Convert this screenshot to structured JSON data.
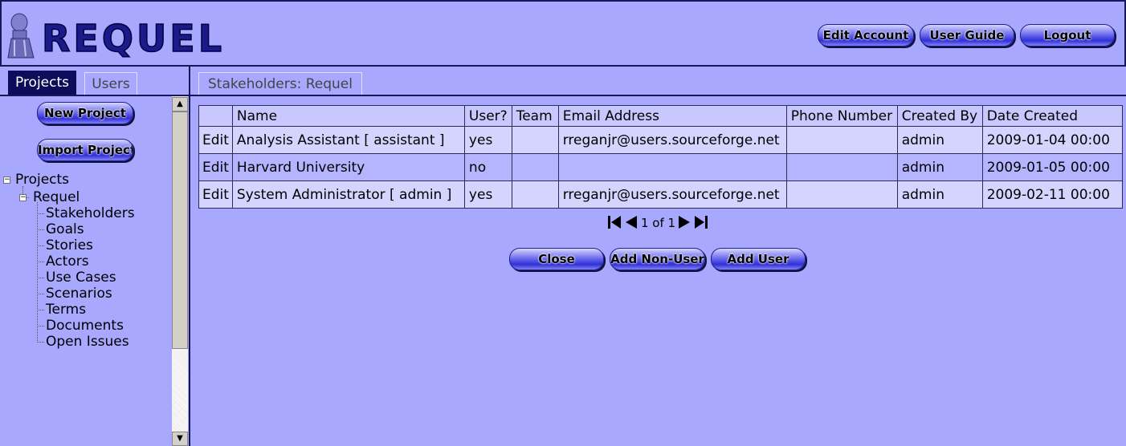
{
  "header": {
    "logo_text": "REQUEL",
    "buttons": {
      "edit_account": "Edit Account",
      "user_guide": "User Guide",
      "logout": "Logout"
    }
  },
  "left": {
    "tabs": {
      "projects": "Projects",
      "users": "Users"
    },
    "buttons": {
      "new_project": "New Project",
      "import_project": "Import Project"
    },
    "tree": {
      "root": "Projects",
      "project": "Requel",
      "items": [
        "Stakeholders",
        "Goals",
        "Stories",
        "Actors",
        "Use Cases",
        "Scenarios",
        "Terms",
        "Documents",
        "Open Issues"
      ]
    }
  },
  "main": {
    "tab": "Stakeholders: Requel",
    "table": {
      "headers": [
        "",
        "Name",
        "User?",
        "Team",
        "Email Address",
        "Phone Number",
        "Created By",
        "Date Created"
      ],
      "rows": [
        [
          "Edit",
          "Analysis Assistant [ assistant ]",
          "yes",
          "",
          "rreganjr@users.sourceforge.net",
          "",
          "admin",
          "2009-01-04 00:00"
        ],
        [
          "Edit",
          "Harvard University",
          "no",
          "",
          "",
          "",
          "admin",
          "2009-01-05 00:00"
        ],
        [
          "Edit",
          "System Administrator [ admin ]",
          "yes",
          "",
          "rreganjr@users.sourceforge.net",
          "",
          "admin",
          "2009-02-11 00:00"
        ]
      ]
    },
    "pager": "1 of 1",
    "buttons": {
      "close": "Close",
      "add_non_user": "Add Non-User",
      "add_user": "Add User"
    }
  }
}
